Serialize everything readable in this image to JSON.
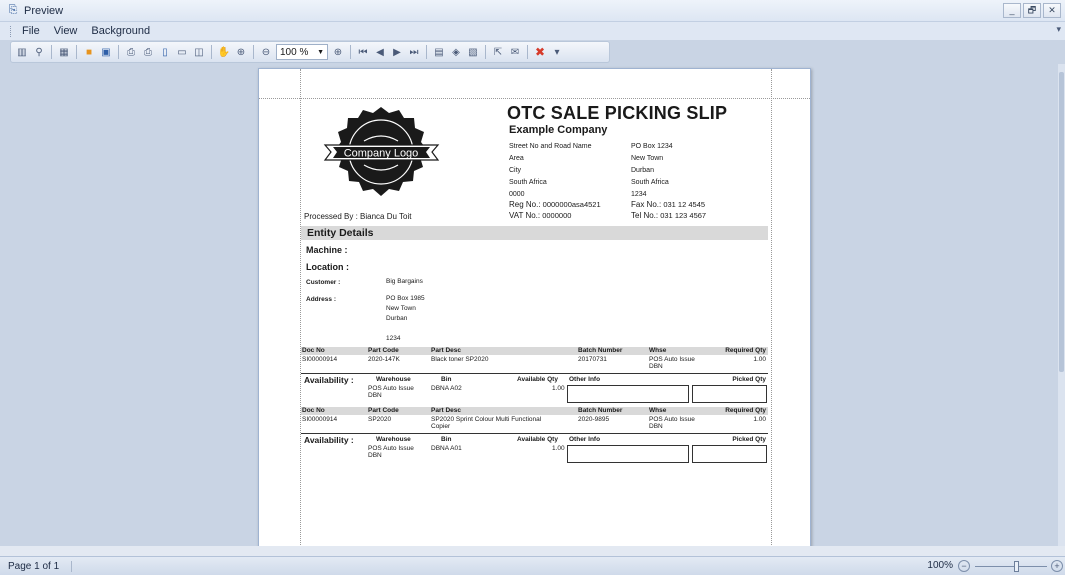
{
  "window": {
    "title": "Preview",
    "btn_min": "_",
    "btn_restore": "🗗",
    "btn_close": "✕"
  },
  "menu": [
    "File",
    "View",
    "Background"
  ],
  "toolbar": {
    "zoom_value": "100 %"
  },
  "report": {
    "title": "OTC SALE PICKING SLIP",
    "company": "Example Company",
    "logo_text": "Company Logo",
    "address_left": [
      "Street No and Road Name",
      "Area",
      "City",
      "South Africa",
      "0000"
    ],
    "address_right": [
      "PO Box 1234",
      "New Town",
      "Durban",
      "South Africa",
      "1234"
    ],
    "reg_label": "Reg No.:",
    "reg_value": "0000000asa4521",
    "vat_label": "VAT No.:",
    "vat_value": "0000000",
    "fax_label": "Fax No.:",
    "fax_value": "031 12 4545",
    "tel_label": "Tel No.:",
    "tel_value": "031 123 4567",
    "processed_by": "Processed By : Bianca Du Toit",
    "entity_title": "Entity Details",
    "machine_label": "Machine :",
    "location_label": "Location :",
    "customer_label": "Customer :",
    "customer_value": "Big Bargains",
    "address_label": "Address :",
    "customer_address": [
      "PO Box 1985",
      "New Town",
      "Durban",
      "",
      "1234"
    ],
    "columns": {
      "doc_no": "Doc No",
      "part_code": "Part Code",
      "part_desc": "Part Desc",
      "batch": "Batch Number",
      "whse": "Whse",
      "req_qty": "Required Qty"
    },
    "avail_columns": {
      "label": "Availability :",
      "warehouse": "Warehouse",
      "bin": "Bin",
      "available_qty": "Available Qty",
      "other_info": "Other Info",
      "picked_qty": "Picked Qty"
    },
    "lines": [
      {
        "doc_no": "SI00000914",
        "part_code": "2020-147K",
        "part_desc": "Black toner SP2020",
        "part_desc_2": "",
        "batch": "20170731",
        "whse": "POS Auto Issue",
        "whse_2": "DBN",
        "req_qty": "1.00",
        "avail_warehouse": "POS Auto Issue",
        "avail_warehouse_2": "DBN",
        "avail_bin": "DBNA A02",
        "avail_qty": "1.00"
      },
      {
        "doc_no": "SI00000914",
        "part_code": "SP2020",
        "part_desc": "SP2020 Sprint Colour Multi Functional",
        "part_desc_2": "Copier",
        "batch": "2020-9895",
        "whse": "POS Auto Issue",
        "whse_2": "DBN",
        "req_qty": "1.00",
        "avail_warehouse": "POS Auto Issue",
        "avail_warehouse_2": "DBN",
        "avail_bin": "DBNA A01",
        "avail_qty": "1.00"
      }
    ]
  },
  "status": {
    "page": "Page 1 of 1",
    "zoom": "100%"
  }
}
